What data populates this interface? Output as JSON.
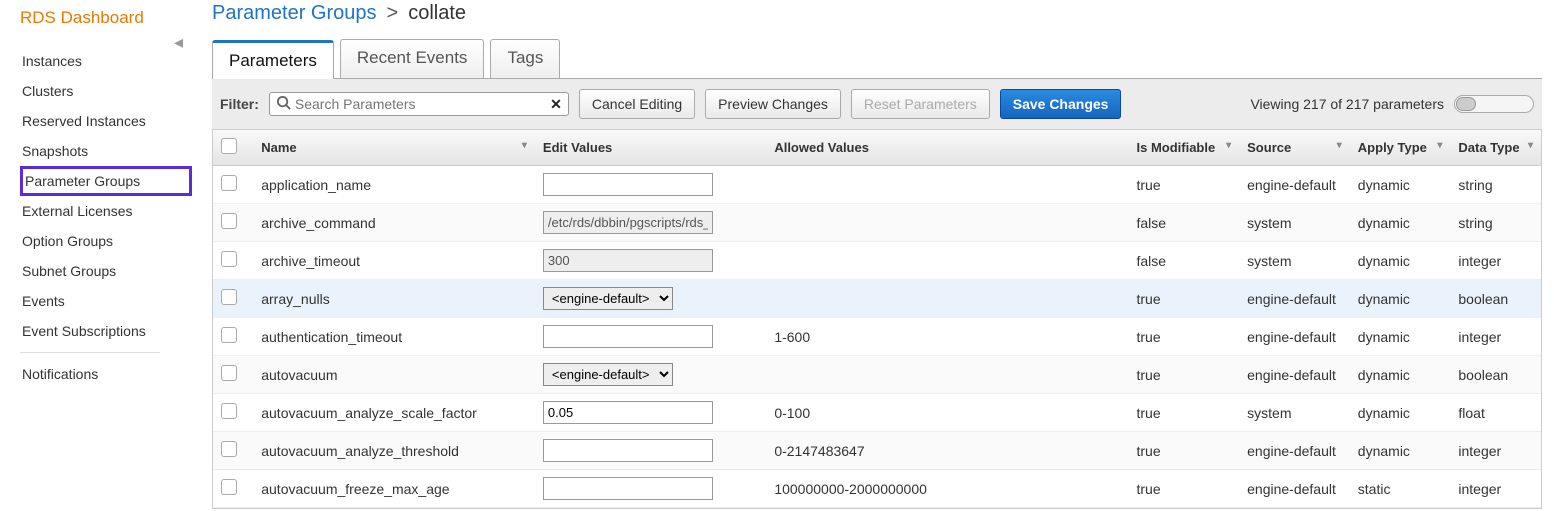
{
  "sidebar": {
    "title": "RDS Dashboard",
    "items": [
      {
        "label": "Instances",
        "highlighted": false
      },
      {
        "label": "Clusters",
        "highlighted": false
      },
      {
        "label": "Reserved Instances",
        "highlighted": false
      },
      {
        "label": "Snapshots",
        "highlighted": false
      },
      {
        "label": "Parameter Groups",
        "highlighted": true
      },
      {
        "label": "External Licenses",
        "highlighted": false
      },
      {
        "label": "Option Groups",
        "highlighted": false
      },
      {
        "label": "Subnet Groups",
        "highlighted": false
      },
      {
        "label": "Events",
        "highlighted": false
      },
      {
        "label": "Event Subscriptions",
        "highlighted": false
      }
    ],
    "secondary": [
      {
        "label": "Notifications"
      }
    ]
  },
  "breadcrumb": {
    "root": "Parameter Groups",
    "sep": ">",
    "current": "collate"
  },
  "tabs": [
    {
      "label": "Parameters",
      "active": true
    },
    {
      "label": "Recent Events",
      "active": false
    },
    {
      "label": "Tags",
      "active": false
    }
  ],
  "toolbar": {
    "filter_label": "Filter:",
    "search_placeholder": "Search Parameters",
    "cancel": "Cancel Editing",
    "preview": "Preview Changes",
    "reset": "Reset Parameters",
    "save": "Save Changes",
    "viewing": "Viewing 217 of 217 parameters"
  },
  "columns": {
    "name": "Name",
    "edit": "Edit Values",
    "allowed": "Allowed Values",
    "modifiable": "Is Modifiable",
    "source": "Source",
    "apply": "Apply Type",
    "datatype": "Data Type"
  },
  "rows": [
    {
      "name": "application_name",
      "edit_type": "text",
      "edit_value": "",
      "allowed": "",
      "modifiable": "true",
      "source": "engine-default",
      "apply": "dynamic",
      "datatype": "string",
      "readonly": false
    },
    {
      "name": "archive_command",
      "edit_type": "text",
      "edit_value": "/etc/rds/dbbin/pgscripts/rds_",
      "allowed": "",
      "modifiable": "false",
      "source": "system",
      "apply": "dynamic",
      "datatype": "string",
      "readonly": true
    },
    {
      "name": "archive_timeout",
      "edit_type": "text",
      "edit_value": "300",
      "allowed": "",
      "modifiable": "false",
      "source": "system",
      "apply": "dynamic",
      "datatype": "integer",
      "readonly": true
    },
    {
      "name": "array_nulls",
      "edit_type": "select",
      "edit_value": "<engine-default>",
      "allowed": "",
      "modifiable": "true",
      "source": "engine-default",
      "apply": "dynamic",
      "datatype": "boolean",
      "readonly": false,
      "highlight": true
    },
    {
      "name": "authentication_timeout",
      "edit_type": "text",
      "edit_value": "",
      "allowed": "1-600",
      "modifiable": "true",
      "source": "engine-default",
      "apply": "dynamic",
      "datatype": "integer",
      "readonly": false
    },
    {
      "name": "autovacuum",
      "edit_type": "select",
      "edit_value": "<engine-default>",
      "allowed": "",
      "modifiable": "true",
      "source": "engine-default",
      "apply": "dynamic",
      "datatype": "boolean",
      "readonly": false
    },
    {
      "name": "autovacuum_analyze_scale_factor",
      "edit_type": "text",
      "edit_value": "0.05",
      "allowed": "0-100",
      "modifiable": "true",
      "source": "system",
      "apply": "dynamic",
      "datatype": "float",
      "readonly": false
    },
    {
      "name": "autovacuum_analyze_threshold",
      "edit_type": "text",
      "edit_value": "",
      "allowed": "0-2147483647",
      "modifiable": "true",
      "source": "engine-default",
      "apply": "dynamic",
      "datatype": "integer",
      "readonly": false
    },
    {
      "name": "autovacuum_freeze_max_age",
      "edit_type": "text",
      "edit_value": "",
      "allowed": "100000000-2000000000",
      "modifiable": "true",
      "source": "engine-default",
      "apply": "static",
      "datatype": "integer",
      "readonly": false
    }
  ]
}
